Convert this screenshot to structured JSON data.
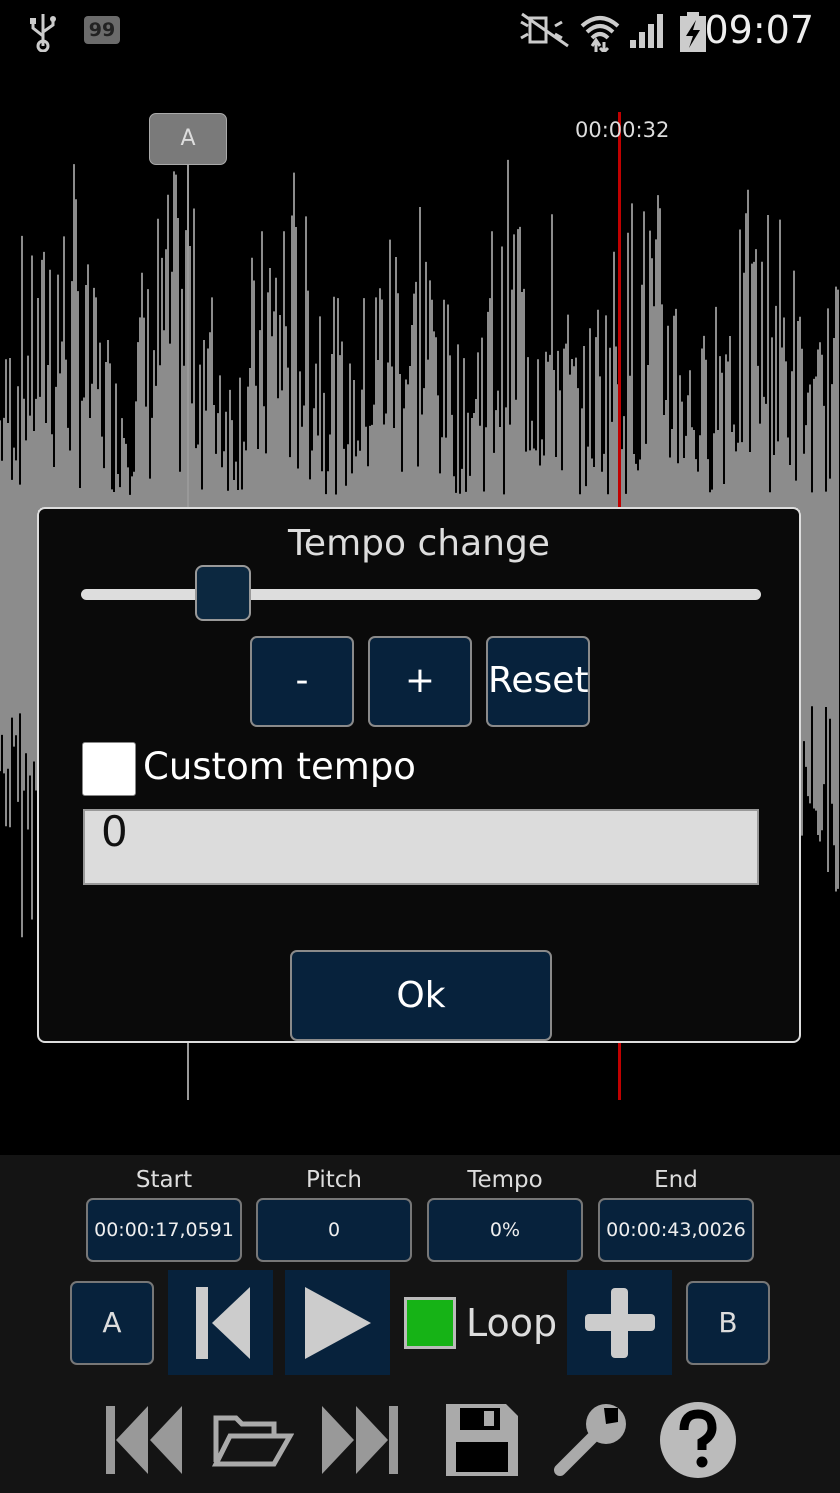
{
  "status_bar": {
    "icons": [
      "usb-icon",
      "notification-count-icon",
      "mute-icon",
      "wifi-icon",
      "signal-icon",
      "battery-charging-icon"
    ],
    "notification_count": "99",
    "time": "09:07"
  },
  "waveform": {
    "marker_a_label": "A",
    "playhead_time": "00:00:32",
    "colors": {
      "wave": "#c8c8c8",
      "playhead": "#c00000"
    }
  },
  "dialog": {
    "title": "Tempo change",
    "slider_icon": "tempo-slider",
    "minus_label": "-",
    "plus_label": "+",
    "reset_label": "Reset",
    "custom_tempo_label": "Custom tempo",
    "custom_tempo_checked": false,
    "custom_tempo_value": "0",
    "ok_label": "Ok"
  },
  "panel": {
    "labels": {
      "start": "Start",
      "pitch": "Pitch",
      "tempo": "Tempo",
      "end": "End"
    },
    "values": {
      "start": "00:00:17,0591",
      "pitch": "0",
      "tempo": "0%",
      "end": "00:00:43,0026"
    },
    "a_label": "A",
    "b_label": "B",
    "loop_label": "Loop",
    "loop_checked": true,
    "loop_color": "#16b316",
    "toolbar_icons": [
      "skip-to-start-icon",
      "open-folder-icon",
      "skip-to-end-icon",
      "save-icon",
      "settings-wrench-icon",
      "help-icon"
    ]
  }
}
